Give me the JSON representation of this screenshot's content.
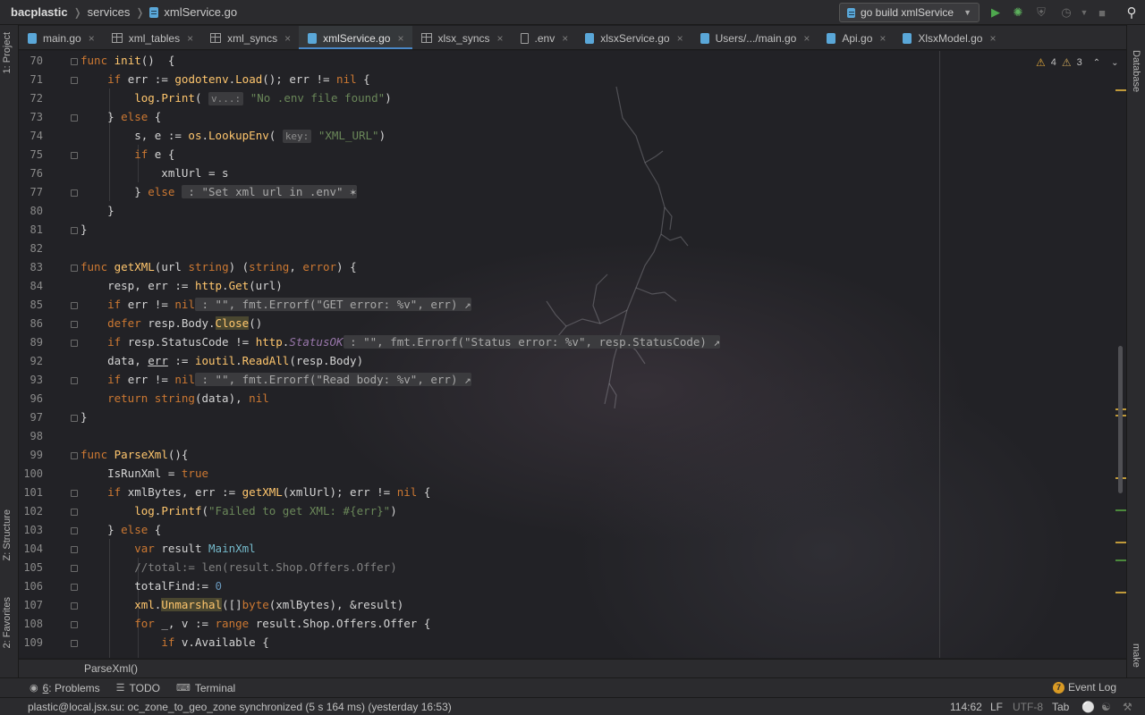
{
  "navbar": {
    "project": "bacplastic",
    "folder": "services",
    "file": "xmlService.go",
    "run_config": "go build xmlService"
  },
  "left_strip": {
    "project": "1: Project",
    "structure": "Z: Structure",
    "favorites": "2: Favorites"
  },
  "right_strip": {
    "database": "Database",
    "make": "make"
  },
  "tabs": [
    {
      "label": "main.go",
      "icon": "go-file-icon"
    },
    {
      "label": "xml_tables",
      "icon": "table-icon"
    },
    {
      "label": "xml_syncs",
      "icon": "table-icon"
    },
    {
      "label": "xmlService.go",
      "icon": "go-file-icon",
      "active": true
    },
    {
      "label": "xlsx_syncs",
      "icon": "table-icon"
    },
    {
      "label": ".env",
      "icon": "env-file-icon"
    },
    {
      "label": "xlsxService.go",
      "icon": "go-file-icon"
    },
    {
      "label": "Users/.../main.go",
      "icon": "go-file-icon"
    },
    {
      "label": "Api.go",
      "icon": "go-file-icon"
    },
    {
      "label": "XlsxModel.go",
      "icon": "go-file-icon"
    }
  ],
  "inspections": {
    "warnings": "4",
    "weak_warnings": "3"
  },
  "editor": {
    "line_numbers": [
      "70",
      "71",
      "72",
      "73",
      "74",
      "75",
      "76",
      "77",
      "80",
      "81",
      "82",
      "83",
      "84",
      "85",
      "86",
      "89",
      "92",
      "93",
      "96",
      "97",
      "98",
      "99",
      "100",
      "101",
      "102",
      "103",
      "104",
      "105",
      "106",
      "107",
      "108",
      "109"
    ]
  },
  "code_breadcrumb": "ParseXml()",
  "tool_windows": {
    "problems_num": "6",
    "problems": ": Problems",
    "todo": "TODO",
    "terminal": "Terminal",
    "event_log": "Event Log",
    "event_count": "7"
  },
  "status": {
    "message": "plastic@local.jsx.su: oc_zone_to_geo_zone synchronized (5 s 164 ms) (yesterday 16:53)",
    "position": "114:62",
    "line_sep": "LF",
    "encoding": "UTF-8",
    "indent": "Tab"
  },
  "colors": {
    "accent": "#4a88c7",
    "keyword": "#cc7832",
    "function": "#ffc66d",
    "string": "#6a8759",
    "number": "#6897bb"
  }
}
